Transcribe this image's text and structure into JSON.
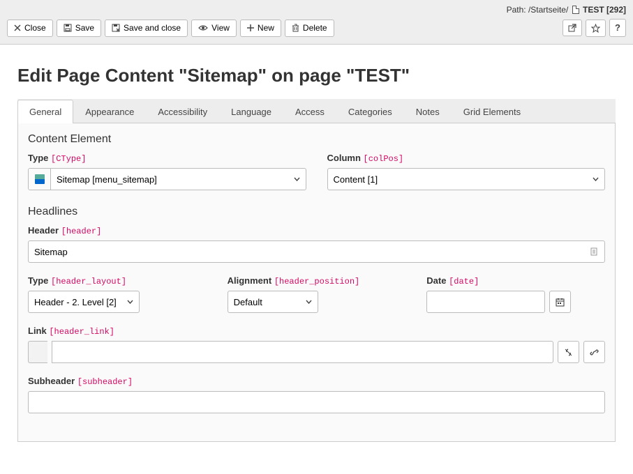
{
  "path": {
    "prefix": "Path: ",
    "segments": "/Startseite/",
    "current": "TEST [292]"
  },
  "toolbar": {
    "close": "Close",
    "save": "Save",
    "save_close": "Save and close",
    "view": "View",
    "new": "New",
    "delete": "Delete"
  },
  "page_title": "Edit Page Content \"Sitemap\" on page \"TEST\"",
  "tabs": [
    "General",
    "Appearance",
    "Accessibility",
    "Language",
    "Access",
    "Categories",
    "Notes",
    "Grid Elements"
  ],
  "active_tab": 0,
  "sections": {
    "content_element": {
      "title": "Content Element",
      "type_label": "Type",
      "type_tech": "[CType]",
      "type_value": "Sitemap [menu_sitemap]",
      "column_label": "Column",
      "column_tech": "[colPos]",
      "column_value": "Content [1]"
    },
    "headlines": {
      "title": "Headlines",
      "header_label": "Header",
      "header_tech": "[header]",
      "header_value": "Sitemap",
      "layout_label": "Type",
      "layout_tech": "[header_layout]",
      "layout_value": "Header - 2. Level [2]",
      "alignment_label": "Alignment",
      "alignment_tech": "[header_position]",
      "alignment_value": "Default",
      "date_label": "Date",
      "date_tech": "[date]",
      "date_value": "",
      "link_label": "Link",
      "link_tech": "[header_link]",
      "link_value": "",
      "subheader_label": "Subheader",
      "subheader_tech": "[subheader]",
      "subheader_value": ""
    }
  }
}
